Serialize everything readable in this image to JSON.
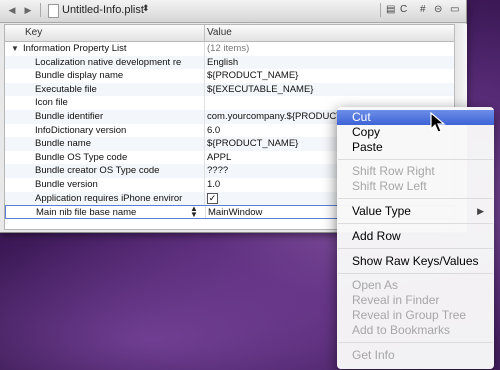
{
  "window": {
    "file_name": "Untitled-Info.plist",
    "file_chevron": "⬍",
    "nav_back": "◀",
    "nav_fwd": "▶",
    "toolbar_c": "C",
    "toolbar_hash": "#",
    "toolbar_link": "⊝"
  },
  "table": {
    "col_key": "Key",
    "col_value": "Value",
    "root": {
      "key": "Information Property List",
      "value": "(12 items)"
    },
    "rows": [
      {
        "key": "Localization native development re",
        "value": "English"
      },
      {
        "key": "Bundle display name",
        "value": "${PRODUCT_NAME}"
      },
      {
        "key": "Executable file",
        "value": "${EXECUTABLE_NAME}"
      },
      {
        "key": "Icon file",
        "value": ""
      },
      {
        "key": "Bundle identifier",
        "value": "com.yourcompany.${PRODUCT_NAME"
      },
      {
        "key": "InfoDictionary version",
        "value": "6.0"
      },
      {
        "key": "Bundle name",
        "value": "${PRODUCT_NAME}"
      },
      {
        "key": "Bundle OS Type code",
        "value": "APPL"
      },
      {
        "key": "Bundle creator OS Type code",
        "value": "????"
      },
      {
        "key": "Bundle version",
        "value": "1.0"
      },
      {
        "key": "Application requires iPhone enviror",
        "value": "✓"
      },
      {
        "key": "Main nib file base name",
        "value": "MainWindow"
      }
    ]
  },
  "context_menu": {
    "cut": "Cut",
    "copy": "Copy",
    "paste": "Paste",
    "shift_right": "Shift Row Right",
    "shift_left": "Shift Row Left",
    "value_type": "Value Type",
    "add_row": "Add Row",
    "show_raw": "Show Raw Keys/Values",
    "open_as": "Open As",
    "reveal_finder": "Reveal in Finder",
    "reveal_group": "Reveal in Group Tree",
    "add_bookmarks": "Add to Bookmarks",
    "get_info": "Get Info",
    "submenu_arrow": "▶"
  }
}
